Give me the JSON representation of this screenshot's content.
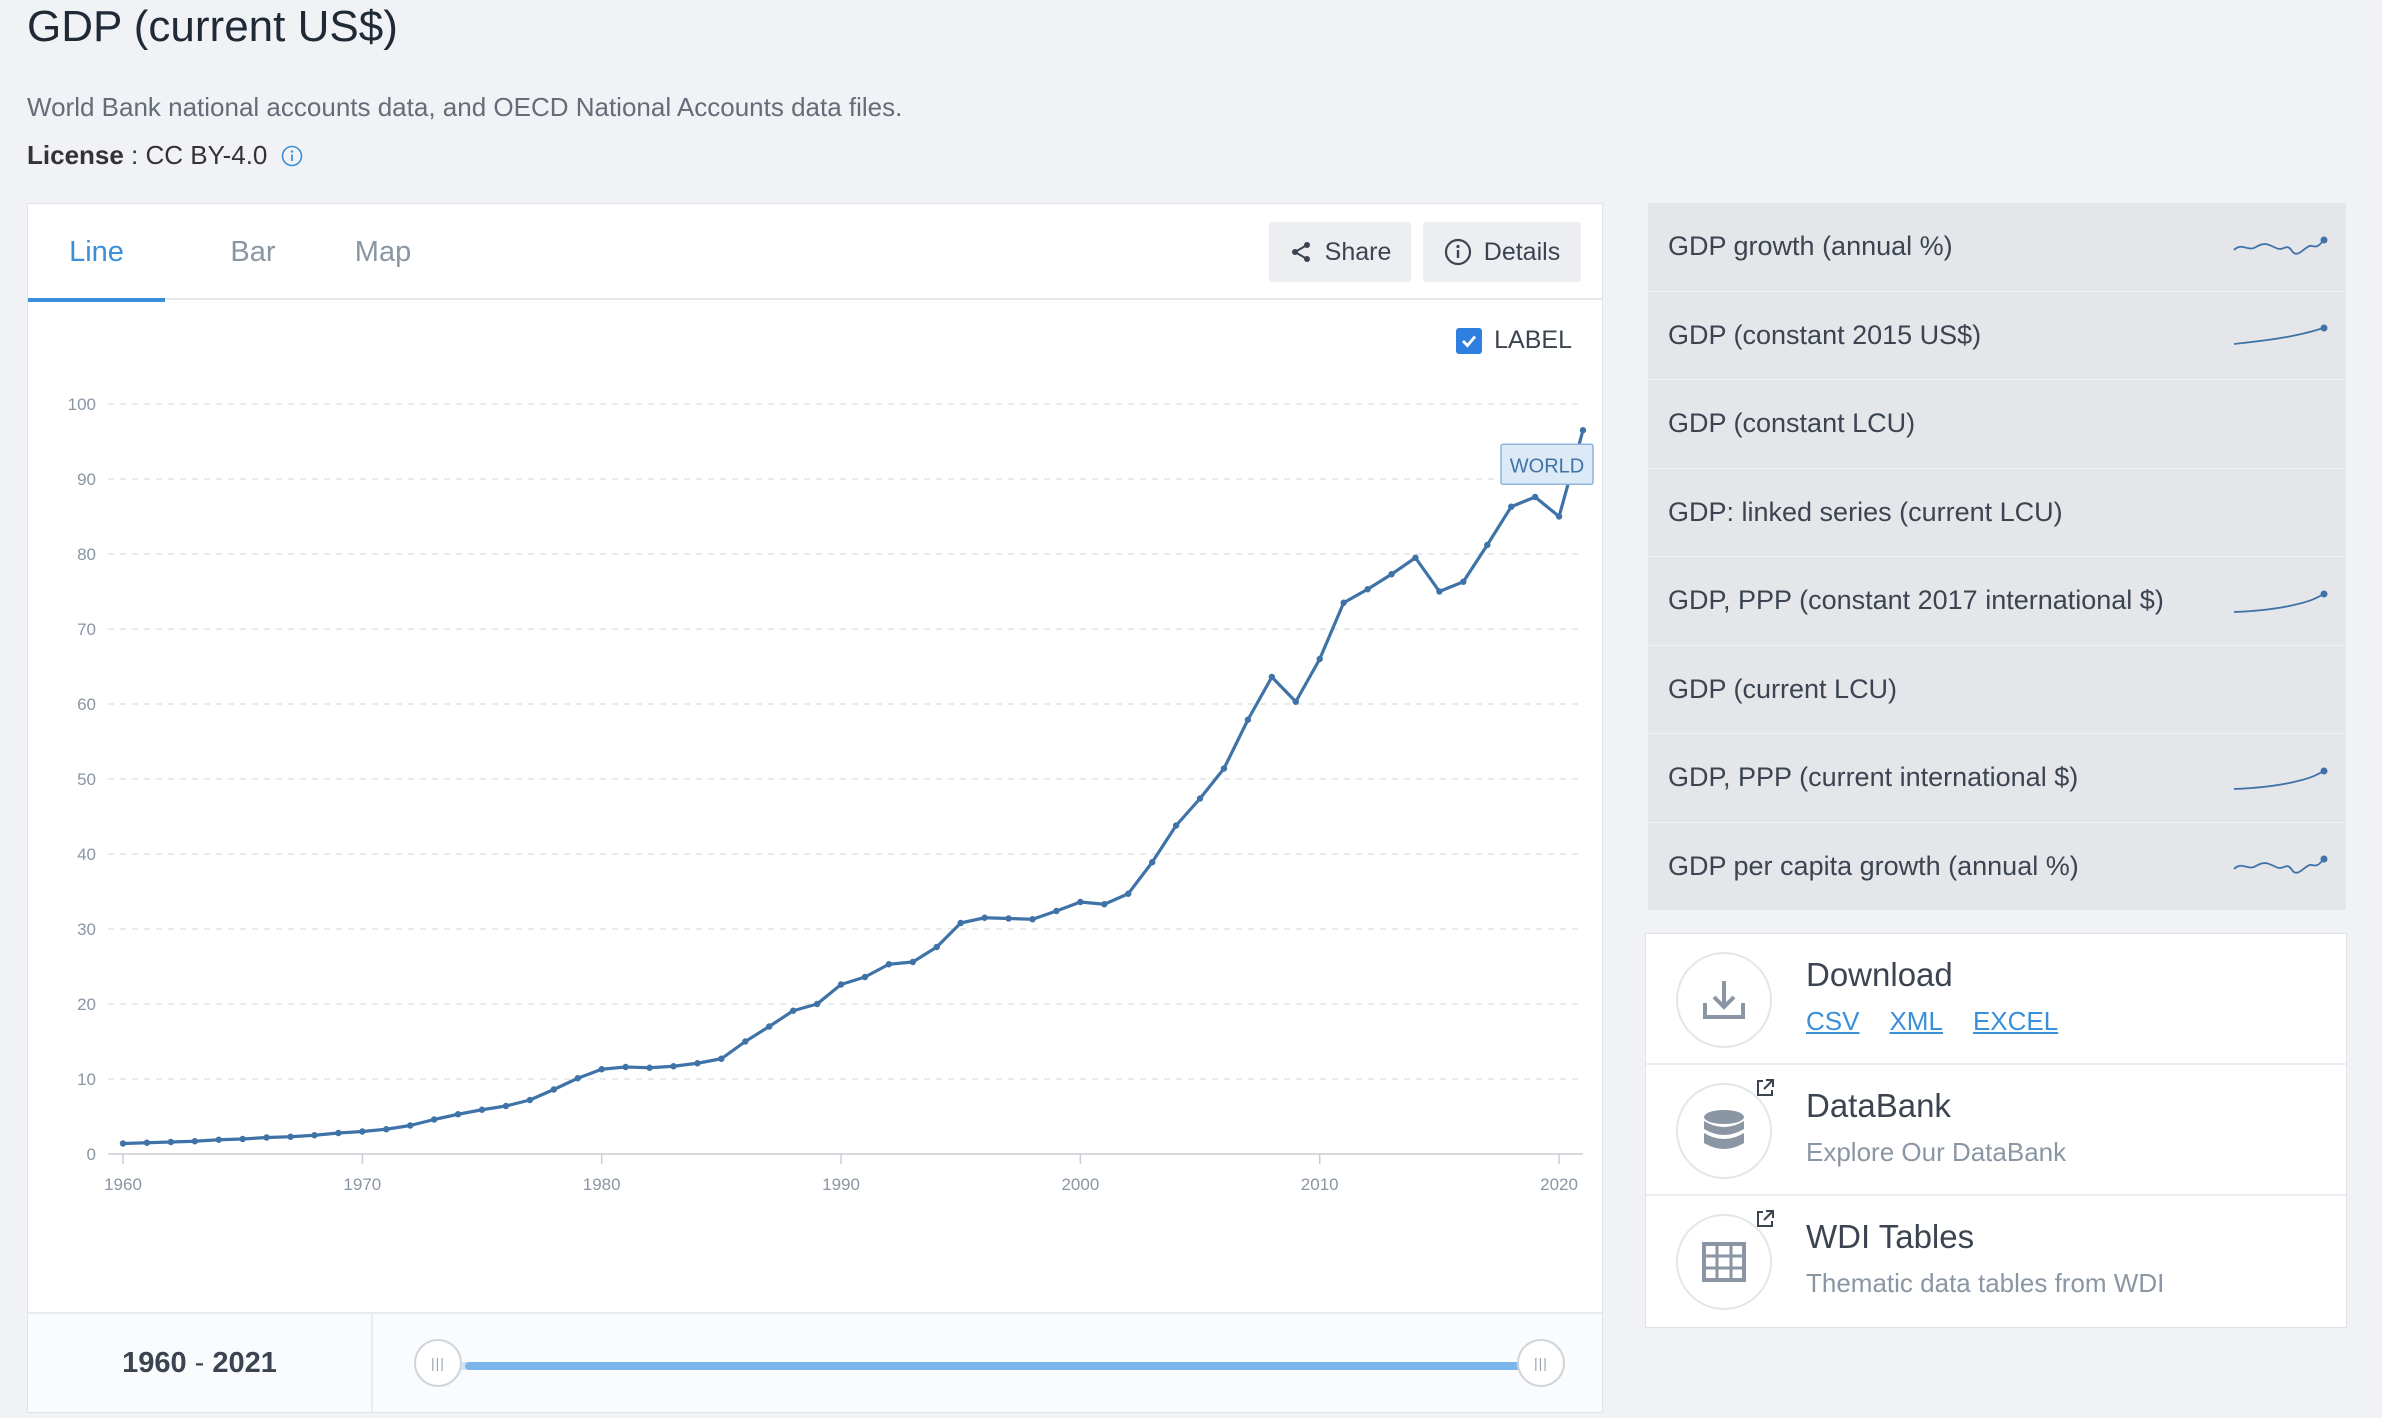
{
  "header": {
    "title": "GDP (current US$)",
    "source": "World Bank national accounts data, and OECD National Accounts data files.",
    "license_label": "License",
    "license_sep": " : ",
    "license_value": "CC BY-4.0"
  },
  "tabs": [
    {
      "label": "Line",
      "active": true
    },
    {
      "label": "Bar",
      "active": false
    },
    {
      "label": "Map",
      "active": false
    }
  ],
  "toolbar": {
    "share_label": "Share",
    "details_label": "Details"
  },
  "label_toggle": {
    "label": "LABEL",
    "checked": true
  },
  "range": {
    "start": "1960",
    "sep": "-",
    "end": "2021"
  },
  "chart_data": {
    "type": "line",
    "title": "",
    "xlabel": "",
    "ylabel": "",
    "xlim": [
      1960,
      2021
    ],
    "ylim": [
      0,
      100
    ],
    "x_ticks": [
      "1960",
      "1970",
      "1980",
      "1990",
      "2000",
      "2010",
      "2020"
    ],
    "y_ticks": [
      "0",
      "10",
      "20",
      "30",
      "40",
      "50",
      "60",
      "70",
      "80",
      "90",
      "100"
    ],
    "grid": true,
    "color": "#3f73a8",
    "series": [
      {
        "name": "WORLD",
        "x": [
          1960,
          1961,
          1962,
          1963,
          1964,
          1965,
          1966,
          1967,
          1968,
          1969,
          1970,
          1971,
          1972,
          1973,
          1974,
          1975,
          1976,
          1977,
          1978,
          1979,
          1980,
          1981,
          1982,
          1983,
          1984,
          1985,
          1986,
          1987,
          1988,
          1989,
          1990,
          1991,
          1992,
          1993,
          1994,
          1995,
          1996,
          1997,
          1998,
          1999,
          2000,
          2001,
          2002,
          2003,
          2004,
          2005,
          2006,
          2007,
          2008,
          2009,
          2010,
          2011,
          2012,
          2013,
          2014,
          2015,
          2016,
          2017,
          2018,
          2019,
          2020,
          2021
        ],
        "values": [
          1.4,
          1.5,
          1.6,
          1.7,
          1.9,
          2.0,
          2.2,
          2.3,
          2.5,
          2.8,
          3.0,
          3.3,
          3.8,
          4.6,
          5.3,
          5.9,
          6.4,
          7.2,
          8.6,
          10.1,
          11.3,
          11.6,
          11.5,
          11.7,
          12.1,
          12.7,
          15.0,
          17.0,
          19.1,
          20.0,
          22.6,
          23.6,
          25.3,
          25.6,
          27.6,
          30.8,
          31.5,
          31.4,
          31.3,
          32.4,
          33.6,
          33.3,
          34.7,
          38.9,
          43.8,
          47.4,
          51.4,
          57.9,
          63.6,
          60.3,
          66.0,
          73.5,
          75.3,
          77.3,
          79.5,
          75.0,
          76.3,
          81.2,
          86.3,
          87.6,
          85.0,
          96.5
        ]
      }
    ]
  },
  "related": [
    {
      "label": "GDP growth (annual %)",
      "spark": "growth"
    },
    {
      "label": "GDP (constant 2015 US$)",
      "spark": "rising"
    },
    {
      "label": "GDP (constant LCU)",
      "spark": ""
    },
    {
      "label": "GDP: linked series (current LCU)",
      "spark": ""
    },
    {
      "label": "GDP, PPP (constant 2017 international $)",
      "spark": "curve"
    },
    {
      "label": "GDP (current LCU)",
      "spark": ""
    },
    {
      "label": "GDP, PPP (current international $)",
      "spark": "curve"
    },
    {
      "label": "GDP per capita growth (annual %)",
      "spark": "growth"
    }
  ],
  "resources": {
    "download": {
      "title": "Download",
      "links": [
        "CSV",
        "XML",
        "EXCEL"
      ]
    },
    "databank": {
      "title": "DataBank",
      "subtitle": "Explore Our DataBank"
    },
    "wdi": {
      "title": "WDI Tables",
      "subtitle": "Thematic data tables from WDI"
    }
  }
}
